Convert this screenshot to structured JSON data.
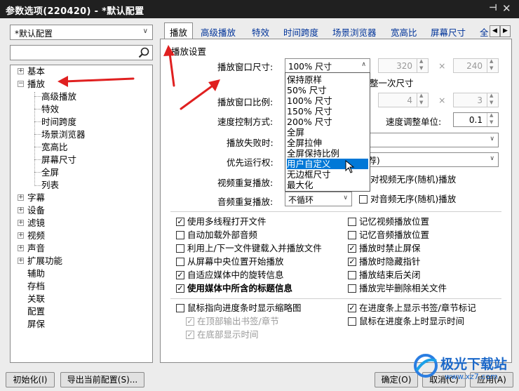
{
  "window": {
    "title": "参数选项(220420) - *默认配置",
    "pin_icon": "pin-icon",
    "close_icon": "close-icon"
  },
  "profile_combo": {
    "value": "*默认配置"
  },
  "search": {
    "placeholder": ""
  },
  "tree": {
    "items": [
      {
        "label": "基本",
        "expander": "+"
      },
      {
        "label": "播放",
        "expander": "−"
      },
      {
        "label": "高级播放"
      },
      {
        "label": "特效"
      },
      {
        "label": "时间跨度"
      },
      {
        "label": "场景浏览器"
      },
      {
        "label": "宽高比"
      },
      {
        "label": "屏幕尺寸"
      },
      {
        "label": "全屏"
      },
      {
        "label": "列表"
      },
      {
        "label": "字幕",
        "expander": "+"
      },
      {
        "label": "设备",
        "expander": "+"
      },
      {
        "label": "滤镜",
        "expander": "+"
      },
      {
        "label": "视频",
        "expander": "+"
      },
      {
        "label": "声音",
        "expander": "+"
      },
      {
        "label": "扩展功能",
        "expander": "+"
      },
      {
        "label": "辅助"
      },
      {
        "label": "存档"
      },
      {
        "label": "关联"
      },
      {
        "label": "配置"
      },
      {
        "label": "屏保"
      }
    ]
  },
  "tabs": [
    "播放",
    "高级播放",
    "特效",
    "时间跨度",
    "场景浏览器",
    "宽高比",
    "屏幕尺寸",
    "全"
  ],
  "tab_scroll": {
    "left": "◀",
    "right": "▶"
  },
  "panel": {
    "group_title": "播放设置",
    "window_size_label": "播放窗口尺寸:",
    "window_size_value": "100% 尺寸",
    "width_value": "320",
    "height_value": "240",
    "times_sign": "×",
    "remember_size_text": "整一次尺寸",
    "ratio_label": "播放窗口比例:",
    "ratio_w": "4",
    "ratio_h": "3",
    "speed_label": "速度控制方式:",
    "speed_unit_label": "速度调整单位:",
    "speed_unit_value": "0.1",
    "fail_label": "播放失败时:",
    "priority_label": "优先运行权:",
    "priority_value": "荐)",
    "video_repeat_label": "视频重复播放:",
    "video_random_text": "对视频无序(随机)播放",
    "audio_repeat_label": "音频重复播放:",
    "audio_repeat_value": "不循环",
    "audio_random_text": "对音频无序(随机)播放"
  },
  "dropdown": {
    "options": [
      "保持原样",
      "50% 尺寸",
      "100% 尺寸",
      "150% 尺寸",
      "200% 尺寸",
      "全屏",
      "全屏拉伸",
      "全屏保持比例",
      "用户自定义",
      "无边框尺寸",
      "最大化"
    ],
    "highlighted": "用户自定义"
  },
  "checks_left": [
    {
      "text": "使用多线程打开文件",
      "checked": "✓"
    },
    {
      "text": "自动加载外部音频",
      "checked": ""
    },
    {
      "text": "利用上/下一文件键载入并播放文件",
      "checked": ""
    },
    {
      "text": "从屏幕中央位置开始播放",
      "checked": ""
    },
    {
      "text": "自适应媒体中的旋转信息",
      "checked": "✓"
    },
    {
      "text": "使用媒体中所含的标题信息",
      "checked": "✓"
    }
  ],
  "checks_right": [
    {
      "text": "记忆视频播放位置",
      "checked": ""
    },
    {
      "text": "记忆音频播放位置",
      "checked": ""
    },
    {
      "text": "播放时禁止屏保",
      "checked": "✓"
    },
    {
      "text": "播放时隐藏指针",
      "checked": "✓"
    },
    {
      "text": "播放结束后关闭",
      "checked": ""
    },
    {
      "text": "播放完毕删除相关文件",
      "checked": ""
    }
  ],
  "checks_bottom": {
    "thumb": {
      "text": "鼠标指向进度条时显示缩略图",
      "checked": ""
    },
    "top_bookmark": {
      "text": "在顶部输出书签/章节",
      "checked": "✓"
    },
    "bottom_time": {
      "text": "在底部显示时间",
      "checked": "✓"
    },
    "show_bookmarks": {
      "text": "在进度条上显示书签/章节标记",
      "checked": "✓"
    },
    "show_time": {
      "text": "鼠标在进度条上时显示时间",
      "checked": ""
    }
  },
  "footer": {
    "init_button": "初始化(I)",
    "export_button": "导出当前配置(S)...",
    "ok_button": "确定(O)",
    "cancel_button": "取消(C)",
    "apply_button": "应用(A)"
  },
  "watermark": {
    "text": "极光下载站",
    "url_text": "www.xz7.com"
  },
  "colors": {
    "titlebar": "#202020",
    "highlight": "#0078d7",
    "tab_text": "#003399",
    "annotation_arrow": "#e02020"
  }
}
